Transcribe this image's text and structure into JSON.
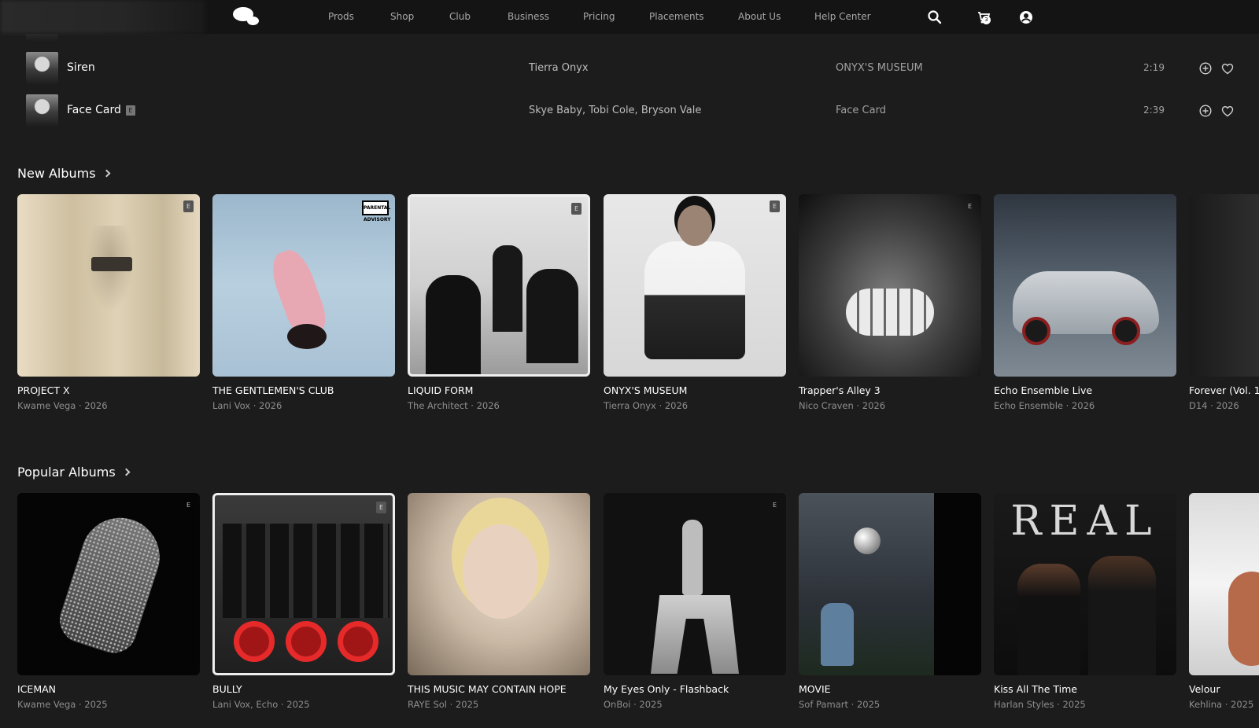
{
  "nav": {
    "links": [
      "Prods",
      "Shop",
      "Club",
      "Business",
      "Pricing",
      "Placements",
      "About Us",
      "Help Center"
    ],
    "cart_count": "3",
    "icons": [
      "search-icon",
      "cart-icon",
      "account-icon"
    ]
  },
  "tracks": [
    {
      "title": "Siren",
      "explicit": "",
      "artist": "Tierra Onyx",
      "album": "ONYX'S MUSEUM",
      "duration": "2:19"
    },
    {
      "title": "Face Card",
      "explicit": "E",
      "artist": "Skye Baby, Tobi Cole, Bryson Vale",
      "album": "Face Card",
      "duration": "2:39"
    }
  ],
  "new_albums": {
    "title": "New Albums",
    "items": [
      {
        "title": "PROJECT X",
        "subtitle": "Kwame Vega · 2026",
        "badge": "E"
      },
      {
        "title": "THE GENTLEMEN'S CLUB",
        "subtitle": "Lani Vox · 2026",
        "badge": "PARENTAL ADVISORY"
      },
      {
        "title": "LIQUID FORM",
        "subtitle": "The Architect · 2026",
        "badge": "E"
      },
      {
        "title": "ONYX'S MUSEUM",
        "subtitle": "Tierra Onyx · 2026",
        "badge": "E"
      },
      {
        "title": "Trapper's Alley 3",
        "subtitle": "Nico Craven · 2026",
        "badge": "E"
      },
      {
        "title": "Echo Ensemble Live",
        "subtitle": "Echo Ensemble · 2026",
        "badge": ""
      },
      {
        "title": "Forever (Vol. 1",
        "subtitle": "D14 · 2026",
        "badge": ""
      }
    ]
  },
  "popular_albums": {
    "title": "Popular Albums",
    "items": [
      {
        "title": "ICEMAN",
        "subtitle": "Kwame Vega · 2025",
        "badge": "E"
      },
      {
        "title": "BULLY",
        "subtitle": "Lani Vox, Echo · 2025",
        "badge": "E"
      },
      {
        "title": "THIS MUSIC MAY CONTAIN HOPE",
        "subtitle": "RAYE Sol · 2025",
        "badge": ""
      },
      {
        "title": "My Eyes Only - Flashback",
        "subtitle": "OnBoi · 2025",
        "badge": "E"
      },
      {
        "title": "MOVIE",
        "subtitle": "Sof Pamart · 2025",
        "badge": ""
      },
      {
        "title": "Kiss All The Time",
        "subtitle": "Harlan Styles · 2025",
        "badge": ""
      },
      {
        "title": "Velour",
        "subtitle": "Kehlina · 2025",
        "badge": ""
      }
    ]
  },
  "cover_text": {
    "real": "REAL"
  }
}
